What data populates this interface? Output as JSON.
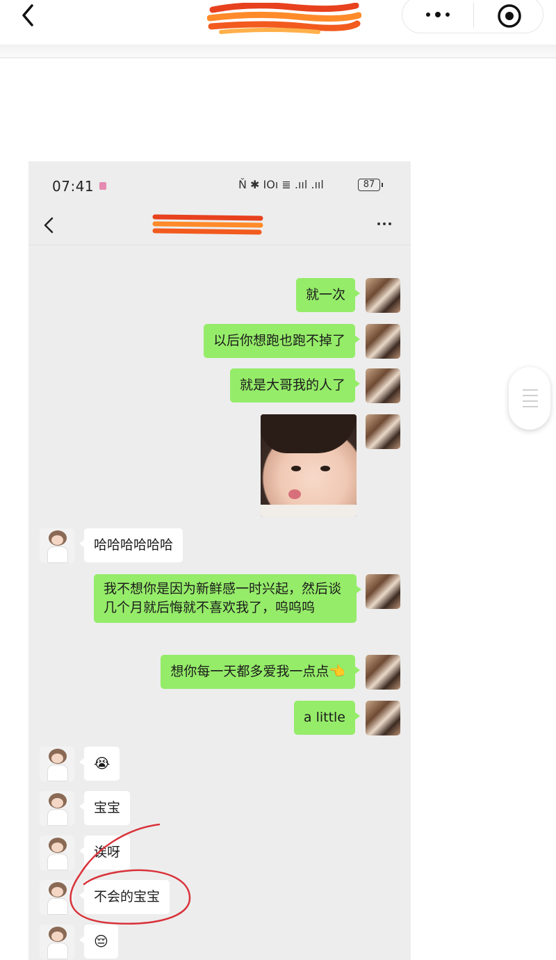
{
  "phone": {
    "status_time": "07:41",
    "status_icons": "Ň ✱ ΙΟı ≣ .ııl .ııl",
    "battery": "87"
  },
  "messages": [
    {
      "side": "me",
      "text": "就一次"
    },
    {
      "side": "me",
      "text": "以后你想跑也跑不掉了"
    },
    {
      "side": "me",
      "text": "就是大哥我的人了"
    },
    {
      "side": "me",
      "type": "image"
    },
    {
      "side": "them",
      "text": "哈哈哈哈哈哈"
    },
    {
      "side": "me",
      "text": "我不想你是因为新鲜感一时兴起，然后谈几个月就后悔就不喜欢我了，呜呜呜"
    },
    {
      "side": "me",
      "text": "想你每一天都多爱我一点点👈"
    },
    {
      "side": "me",
      "text": "a little"
    },
    {
      "side": "them",
      "text": "😭"
    },
    {
      "side": "them",
      "text": "宝宝"
    },
    {
      "side": "them",
      "text": "诶呀"
    },
    {
      "side": "them",
      "text": "不会的宝宝"
    },
    {
      "side": "them",
      "text": "😔"
    }
  ],
  "colors": {
    "my_bubble": "#95ec69",
    "their_bubble": "#ffffff",
    "chat_bg": "#ededed",
    "annotation": "#d9323a"
  }
}
